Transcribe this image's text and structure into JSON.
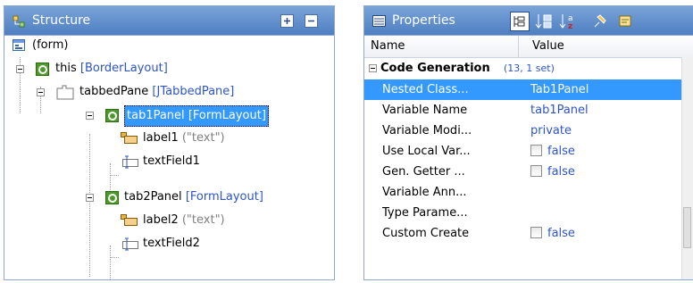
{
  "structure": {
    "title": "Structure",
    "tree": [
      {
        "label": "(form)",
        "detail": ""
      },
      {
        "label": "this",
        "detail": "[BorderLayout]"
      },
      {
        "label": "tabbedPane",
        "detail": "[JTabbedPane]"
      },
      {
        "label": "tab1Panel",
        "detail": "[FormLayout]"
      },
      {
        "label": "label1",
        "detail": "(\"text\")"
      },
      {
        "label": "textField1",
        "detail": ""
      },
      {
        "label": "tab2Panel",
        "detail": "[FormLayout]"
      },
      {
        "label": "label2",
        "detail": "(\"text\")"
      },
      {
        "label": "textField2",
        "detail": ""
      }
    ]
  },
  "properties": {
    "title": "Properties",
    "columns": {
      "name": "Name",
      "value": "Value"
    },
    "category": {
      "label": "Code Generation",
      "count": "(13, 1 set)"
    },
    "rows": [
      {
        "name": "Nested Class...",
        "value": "Tab1Panel",
        "checkbox": false
      },
      {
        "name": "Variable Name",
        "value": "tab1Panel",
        "checkbox": false
      },
      {
        "name": "Variable Modi...",
        "value": "private",
        "checkbox": false
      },
      {
        "name": "Use Local Var...",
        "value": "false",
        "checkbox": true
      },
      {
        "name": "Gen. Getter ...",
        "value": "false",
        "checkbox": true
      },
      {
        "name": "Variable Ann...",
        "value": "",
        "checkbox": false
      },
      {
        "name": "Type Parame...",
        "value": "",
        "checkbox": false
      },
      {
        "name": "Custom Create",
        "value": "false",
        "checkbox": true
      }
    ]
  },
  "colors": {
    "title_bar": "#5b8bcc",
    "selection": "#3399ff",
    "detail_text": "#2d55c7"
  }
}
